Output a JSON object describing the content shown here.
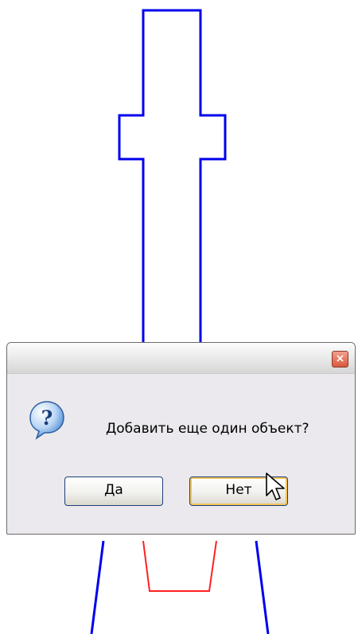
{
  "dialog": {
    "message": "Добавить еще один объект?",
    "close_label": "×",
    "icon": "question-icon",
    "buttons": {
      "yes_label": "Да",
      "no_label": "Нет"
    }
  },
  "colors": {
    "outline": "#0000ee",
    "inner_shape": "#ff2020",
    "accent_focus": "#f2c35a"
  }
}
